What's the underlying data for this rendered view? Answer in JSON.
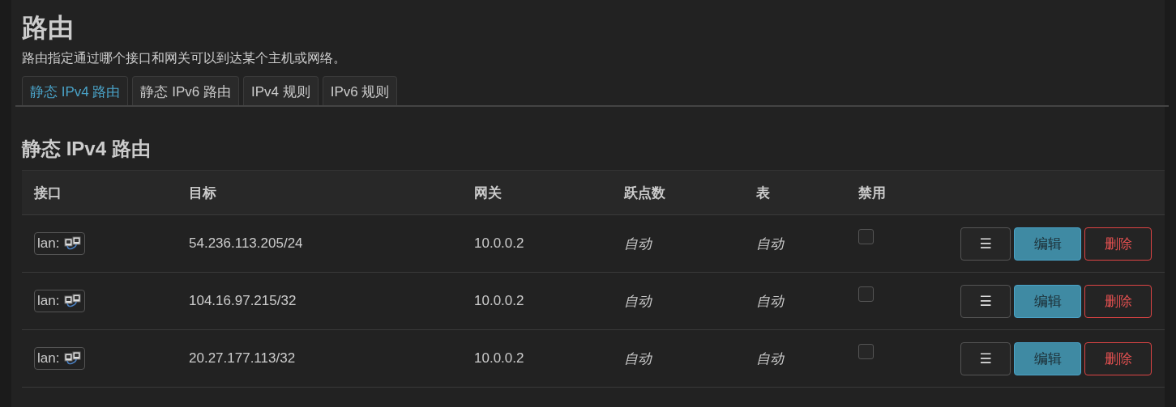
{
  "title": "路由",
  "description": "路由指定通过哪个接口和网关可以到达某个主机或网络。",
  "tabs": [
    {
      "label": "静态 IPv4 路由",
      "selected": true
    },
    {
      "label": "静态 IPv6 路由",
      "selected": false
    },
    {
      "label": "IPv4 规则",
      "selected": false
    },
    {
      "label": "IPv6 规则",
      "selected": false
    }
  ],
  "section_title": "静态 IPv4 路由",
  "table": {
    "columns": [
      "接口",
      "目标",
      "网关",
      "跃点数",
      "表",
      "禁用"
    ],
    "rows": [
      {
        "interface": "lan:",
        "target": "54.236.113.205/24",
        "gateway": "10.0.0.2",
        "metric": "自动",
        "table": "自动",
        "disabled": false,
        "buttons": [
          "☰",
          "编辑",
          "删除"
        ]
      },
      {
        "interface": "lan:",
        "target": "104.16.97.215/32",
        "gateway": "10.0.0.2",
        "metric": "自动",
        "table": "自动",
        "disabled": false,
        "buttons": [
          "☰",
          "编辑",
          "删除"
        ]
      },
      {
        "interface": "lan:",
        "target": "20.27.177.113/32",
        "gateway": "10.0.0.2",
        "metric": "自动",
        "table": "自动",
        "disabled": false,
        "buttons": [
          "☰",
          "编辑",
          "删除"
        ]
      }
    ]
  }
}
